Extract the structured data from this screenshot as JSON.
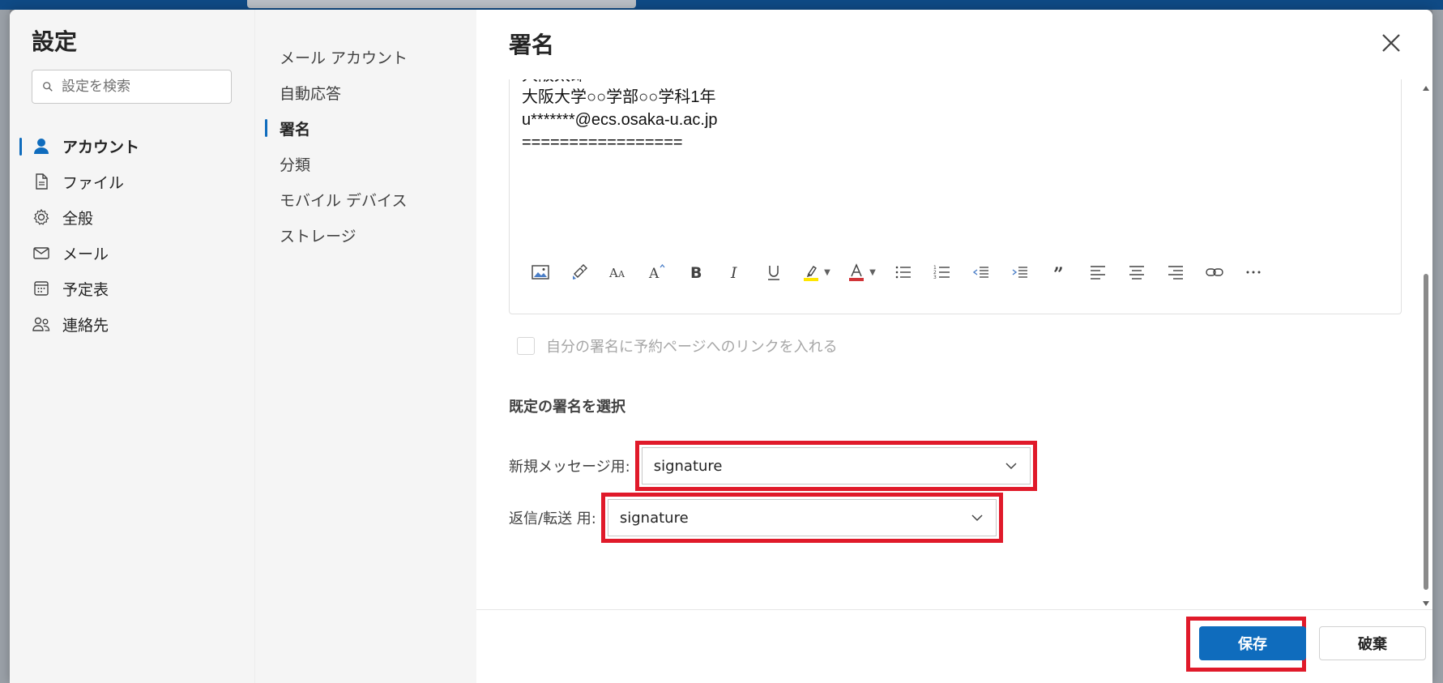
{
  "dialog": {
    "title": "設定",
    "close_icon": "close-icon"
  },
  "search": {
    "placeholder": "設定を検索",
    "icon": "search-icon"
  },
  "nav": {
    "items": [
      {
        "label": "アカウント",
        "icon": "person-icon",
        "active": true
      },
      {
        "label": "ファイル",
        "icon": "document-icon",
        "active": false
      },
      {
        "label": "全般",
        "icon": "gear-icon",
        "active": false
      },
      {
        "label": "メール",
        "icon": "mail-icon",
        "active": false
      },
      {
        "label": "予定表",
        "icon": "calendar-icon",
        "active": false
      },
      {
        "label": "連絡先",
        "icon": "people-icon",
        "active": false
      }
    ]
  },
  "subnav": {
    "items": [
      {
        "label": "メール アカウント",
        "active": false
      },
      {
        "label": "自動応答",
        "active": false
      },
      {
        "label": "署名",
        "active": true
      },
      {
        "label": "分類",
        "active": false
      },
      {
        "label": "モバイル デバイス",
        "active": false
      },
      {
        "label": "ストレージ",
        "active": false
      }
    ]
  },
  "main": {
    "title": "署名",
    "signature_lines": [
      "大阪太郎",
      "大阪大学○○学部○○学科1年",
      "u*******@ecs.osaka-u.ac.jp",
      "================="
    ],
    "toolbar_icons": [
      "insert-image-icon",
      "format-painter-icon",
      "font-size-icon",
      "increase-font-icon",
      "bold-icon",
      "italic-icon",
      "underline-icon",
      "highlight-icon",
      "font-color-icon",
      "bullets-icon",
      "numbering-icon",
      "decrease-indent-icon",
      "increase-indent-icon",
      "quote-icon",
      "align-left-icon",
      "align-center-icon",
      "align-right-icon",
      "link-icon",
      "more-icon"
    ],
    "highlight_color": "#ffe600",
    "font_color": "#d13438",
    "checkbox_label": "自分の署名に予約ページへのリンクを入れる",
    "default_section_title": "既定の署名を選択",
    "new_message": {
      "label": "新規メッセージ用:",
      "value": "signature"
    },
    "reply_forward": {
      "label": "返信/転送 用:",
      "value": "signature"
    }
  },
  "footer": {
    "save_label": "保存",
    "discard_label": "破棄"
  },
  "colors": {
    "accent": "#0f6cbd",
    "highlight_frame": "#e01a2a"
  }
}
